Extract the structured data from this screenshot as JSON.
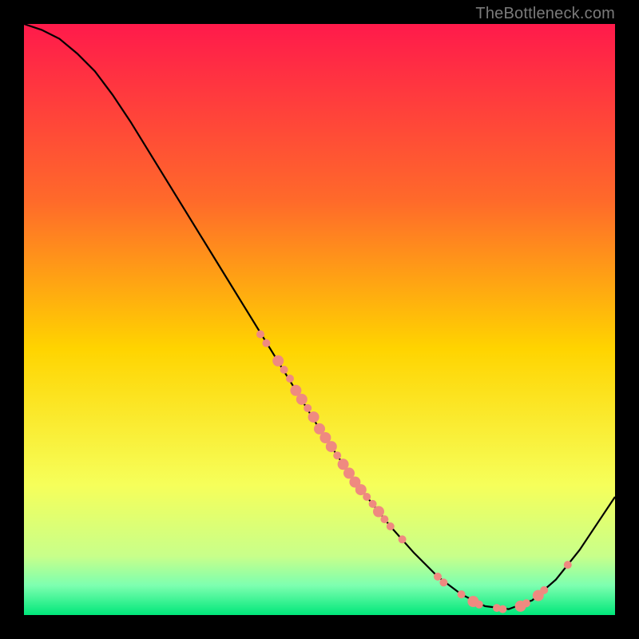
{
  "watermark": {
    "text": "TheBottleneck.com"
  },
  "chart_data": {
    "type": "line",
    "title": "",
    "xlabel": "",
    "ylabel": "",
    "xlim": [
      0,
      100
    ],
    "ylim": [
      0,
      100
    ],
    "background_gradient": {
      "stops": [
        {
          "offset": 0.0,
          "color": "#ff1a4b"
        },
        {
          "offset": 0.3,
          "color": "#ff6a2a"
        },
        {
          "offset": 0.55,
          "color": "#ffd400"
        },
        {
          "offset": 0.78,
          "color": "#f6ff5a"
        },
        {
          "offset": 0.9,
          "color": "#c8ff8a"
        },
        {
          "offset": 0.95,
          "color": "#7dffb0"
        },
        {
          "offset": 1.0,
          "color": "#00e77a"
        }
      ]
    },
    "series": [
      {
        "name": "curve",
        "color": "#000000",
        "x": [
          0,
          3,
          6,
          9,
          12,
          15,
          18,
          22,
          26,
          30,
          34,
          38,
          42,
          46,
          50,
          54,
          58,
          62,
          66,
          70,
          74,
          78,
          82,
          86,
          90,
          94,
          98,
          100
        ],
        "y": [
          100,
          99,
          97.5,
          95,
          92,
          88,
          83.5,
          77,
          70.5,
          64,
          57.5,
          51,
          44.5,
          38,
          31.5,
          25.5,
          20,
          15,
          10.5,
          6.5,
          3.5,
          1.5,
          1,
          2.5,
          6,
          11,
          17,
          20
        ]
      }
    ],
    "markers": {
      "name": "dense-points",
      "color": "#ef8a80",
      "radius_small": 5,
      "radius_large": 7,
      "points": [
        {
          "x": 40,
          "y": 47.5,
          "r": "s"
        },
        {
          "x": 41,
          "y": 46.0,
          "r": "s"
        },
        {
          "x": 43,
          "y": 43.0,
          "r": "l"
        },
        {
          "x": 44,
          "y": 41.5,
          "r": "s"
        },
        {
          "x": 45,
          "y": 40.0,
          "r": "s"
        },
        {
          "x": 46,
          "y": 38.0,
          "r": "l"
        },
        {
          "x": 47,
          "y": 36.5,
          "r": "l"
        },
        {
          "x": 48,
          "y": 35.0,
          "r": "s"
        },
        {
          "x": 49,
          "y": 33.5,
          "r": "l"
        },
        {
          "x": 50,
          "y": 31.5,
          "r": "l"
        },
        {
          "x": 51,
          "y": 30.0,
          "r": "l"
        },
        {
          "x": 52,
          "y": 28.5,
          "r": "l"
        },
        {
          "x": 53,
          "y": 27.0,
          "r": "s"
        },
        {
          "x": 54,
          "y": 25.5,
          "r": "l"
        },
        {
          "x": 55,
          "y": 24.0,
          "r": "l"
        },
        {
          "x": 56,
          "y": 22.5,
          "r": "l"
        },
        {
          "x": 57,
          "y": 21.2,
          "r": "l"
        },
        {
          "x": 58,
          "y": 20.0,
          "r": "s"
        },
        {
          "x": 59,
          "y": 18.8,
          "r": "s"
        },
        {
          "x": 60,
          "y": 17.5,
          "r": "l"
        },
        {
          "x": 61,
          "y": 16.2,
          "r": "s"
        },
        {
          "x": 62,
          "y": 15.0,
          "r": "s"
        },
        {
          "x": 64,
          "y": 12.8,
          "r": "s"
        },
        {
          "x": 70,
          "y": 6.5,
          "r": "s"
        },
        {
          "x": 71,
          "y": 5.5,
          "r": "s"
        },
        {
          "x": 74,
          "y": 3.5,
          "r": "s"
        },
        {
          "x": 76,
          "y": 2.3,
          "r": "l"
        },
        {
          "x": 77,
          "y": 1.8,
          "r": "s"
        },
        {
          "x": 80,
          "y": 1.2,
          "r": "s"
        },
        {
          "x": 81,
          "y": 1.0,
          "r": "s"
        },
        {
          "x": 84,
          "y": 1.5,
          "r": "l"
        },
        {
          "x": 85,
          "y": 2.0,
          "r": "s"
        },
        {
          "x": 87,
          "y": 3.3,
          "r": "l"
        },
        {
          "x": 88,
          "y": 4.2,
          "r": "s"
        },
        {
          "x": 92,
          "y": 8.5,
          "r": "s"
        }
      ]
    }
  }
}
